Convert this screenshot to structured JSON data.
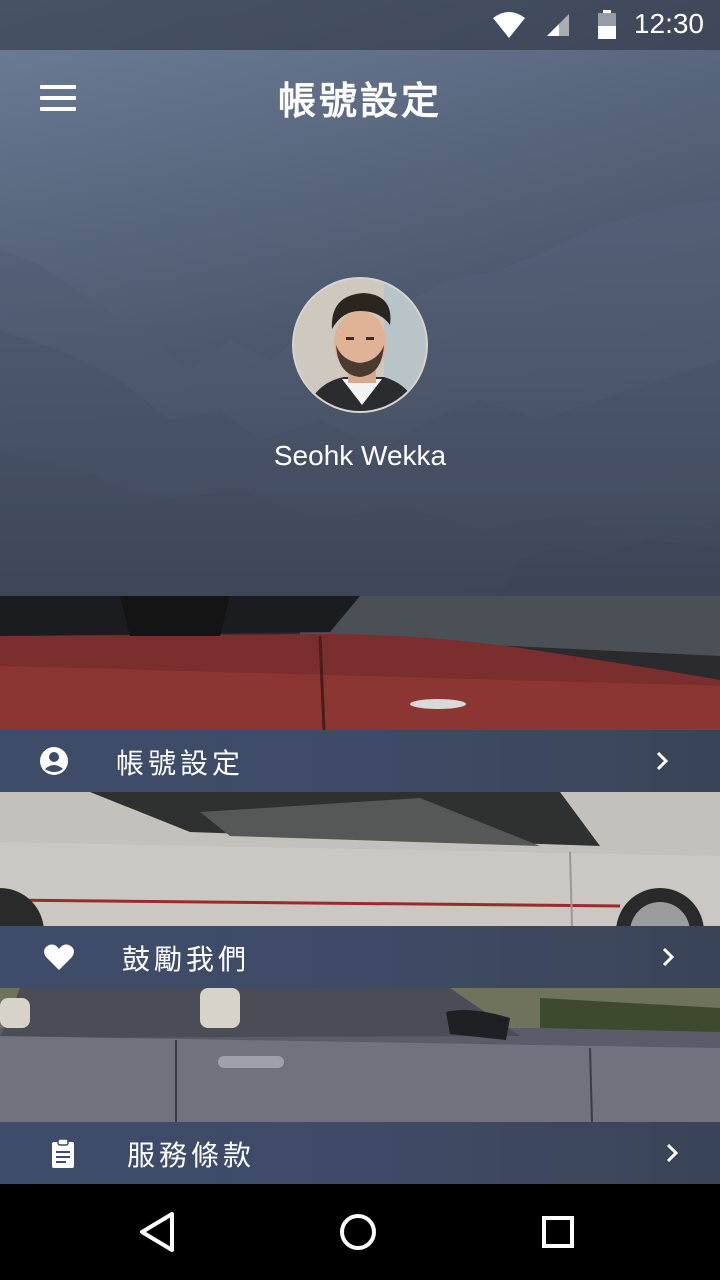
{
  "status_bar": {
    "time": "12:30",
    "icons": [
      "wifi-icon",
      "cell-signal-icon",
      "battery-icon"
    ]
  },
  "app_bar": {
    "menu_icon": "hamburger-menu-icon",
    "title": "帳號設定"
  },
  "profile": {
    "name": "Seohk Wekka",
    "avatar_icon": "user-avatar"
  },
  "menu": {
    "items": [
      {
        "label": "帳號設定",
        "icon": "account-circle-icon",
        "chevron": "chevron-right-icon"
      },
      {
        "label": "鼓勵我們",
        "icon": "heart-icon",
        "chevron": "chevron-right-icon"
      },
      {
        "label": "服務條款",
        "icon": "clipboard-icon",
        "chevron": "chevron-right-icon"
      }
    ]
  },
  "nav_bar": {
    "buttons": [
      "back-triangle-icon",
      "home-circle-icon",
      "recents-square-icon"
    ]
  },
  "colors": {
    "row_background": "#3e4c6b",
    "hero_top": "#6e7f99",
    "hero_bottom": "#3b4351",
    "text": "#ffffff"
  }
}
